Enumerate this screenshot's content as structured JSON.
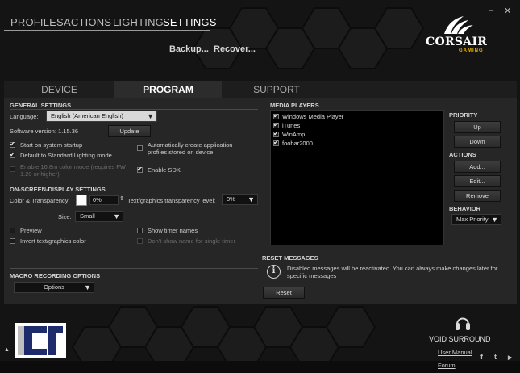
{
  "nav": {
    "items": [
      {
        "label": "PROFILES"
      },
      {
        "label": "ACTIONS"
      },
      {
        "label": "LIGHTING"
      },
      {
        "label": "SETTINGS"
      }
    ],
    "sub_actions": {
      "backup": "Backup...",
      "recover": "Recover..."
    }
  },
  "window_controls": {
    "minimize": "–",
    "close": "✕"
  },
  "brand": {
    "name": "CORSAIR",
    "sub": "GAMING"
  },
  "tabs": [
    {
      "label": "DEVICE"
    },
    {
      "label": "PROGRAM"
    },
    {
      "label": "SUPPORT"
    }
  ],
  "general": {
    "title": "GENERAL SETTINGS",
    "language_label": "Language:",
    "language_value": "English (American English)",
    "version_label": "Software version: 1.15.36",
    "update_button": "Update",
    "start_on_startup": {
      "label": "Start on system startup",
      "checked": true
    },
    "default_lighting": {
      "label": "Default to Standard Lighting mode",
      "checked": true
    },
    "color_mode_16_8m": {
      "label": "Enable 16.8m color mode (requires FW 1.20 or higher)",
      "checked": false,
      "disabled": true
    },
    "auto_profiles": {
      "label": "Automatically create application profiles stored on device",
      "checked": false
    },
    "enable_sdk": {
      "label": "Enable SDK",
      "checked": true
    }
  },
  "osd": {
    "title": "ON-SCREEN-DISPLAY SETTINGS",
    "color_label": "Color & Transparency:",
    "color_value": "0%",
    "text_transparency_label": "Text/graphics transparency level:",
    "text_transparency_value": "0%",
    "size_label": "Size:",
    "size_value": "Small",
    "preview": {
      "label": "Preview",
      "checked": false
    },
    "invert": {
      "label": "Invert text/graphics color",
      "checked": false
    },
    "show_timer_names": {
      "label": "Show timer names",
      "checked": false
    },
    "dont_show_single": {
      "label": "Don't show name for single timer",
      "checked": false,
      "disabled": true
    }
  },
  "macro": {
    "title": "MACRO RECORDING OPTIONS",
    "options_label": "Options"
  },
  "media_players": {
    "title": "MEDIA PLAYERS",
    "items": [
      {
        "label": "Windows Media Player",
        "checked": true
      },
      {
        "label": "iTunes",
        "checked": true
      },
      {
        "label": "WinAmp",
        "checked": true
      },
      {
        "label": "foobar2000",
        "checked": true
      }
    ]
  },
  "priority": {
    "title": "PRIORITY",
    "up": "Up",
    "down": "Down"
  },
  "actions": {
    "title": "ACTIONS",
    "add": "Add...",
    "edit": "Edit...",
    "remove": "Remove"
  },
  "behavior": {
    "title": "BEHAVIOR",
    "value": "Max Priority"
  },
  "reset": {
    "title": "RESET MESSAGES",
    "message": "Disabled messages will be reactivated. You can always make changes later for specific messages",
    "button": "Reset"
  },
  "footer": {
    "device_name": "VOID SURROUND",
    "user_manual": "User Manual",
    "forum": "Forum",
    "social": [
      {
        "icon": "facebook-icon",
        "glyph": "f"
      },
      {
        "icon": "twitter-icon",
        "glyph": "t"
      },
      {
        "icon": "youtube-icon",
        "glyph": "▶"
      }
    ]
  },
  "colors": {
    "accent": "#e8b400",
    "background": "#141414",
    "panel": "#262626"
  }
}
